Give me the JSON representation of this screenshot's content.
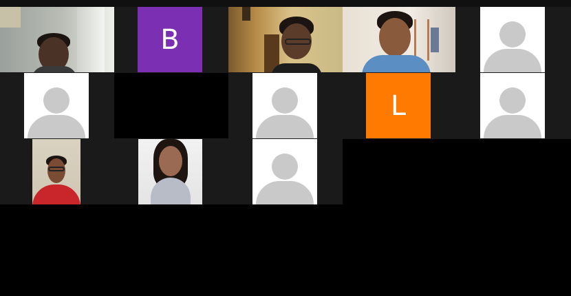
{
  "colors": {
    "background": "#000000",
    "grid_background": "#1a1a1a",
    "avatar_tile": "#ffffff",
    "avatar_silhouette": "#c9c9c9",
    "initial_b": "#7b2fb2",
    "initial_l": "#ff7a00"
  },
  "participants": [
    {
      "kind": "video",
      "icon": "participant-video"
    },
    {
      "kind": "initial",
      "initial": "B",
      "color": "#7b2fb2"
    },
    {
      "kind": "video",
      "icon": "participant-video"
    },
    {
      "kind": "video",
      "icon": "participant-video"
    },
    {
      "kind": "avatar",
      "icon": "default-avatar-icon"
    },
    {
      "kind": "avatar",
      "icon": "default-avatar-icon"
    },
    {
      "kind": "black"
    },
    {
      "kind": "avatar",
      "icon": "default-avatar-icon"
    },
    {
      "kind": "initial",
      "initial": "L",
      "color": "#ff7a00"
    },
    {
      "kind": "avatar",
      "icon": "default-avatar-icon"
    },
    {
      "kind": "video",
      "icon": "participant-video"
    },
    {
      "kind": "video",
      "icon": "participant-video"
    },
    {
      "kind": "avatar",
      "icon": "default-avatar-icon"
    }
  ]
}
